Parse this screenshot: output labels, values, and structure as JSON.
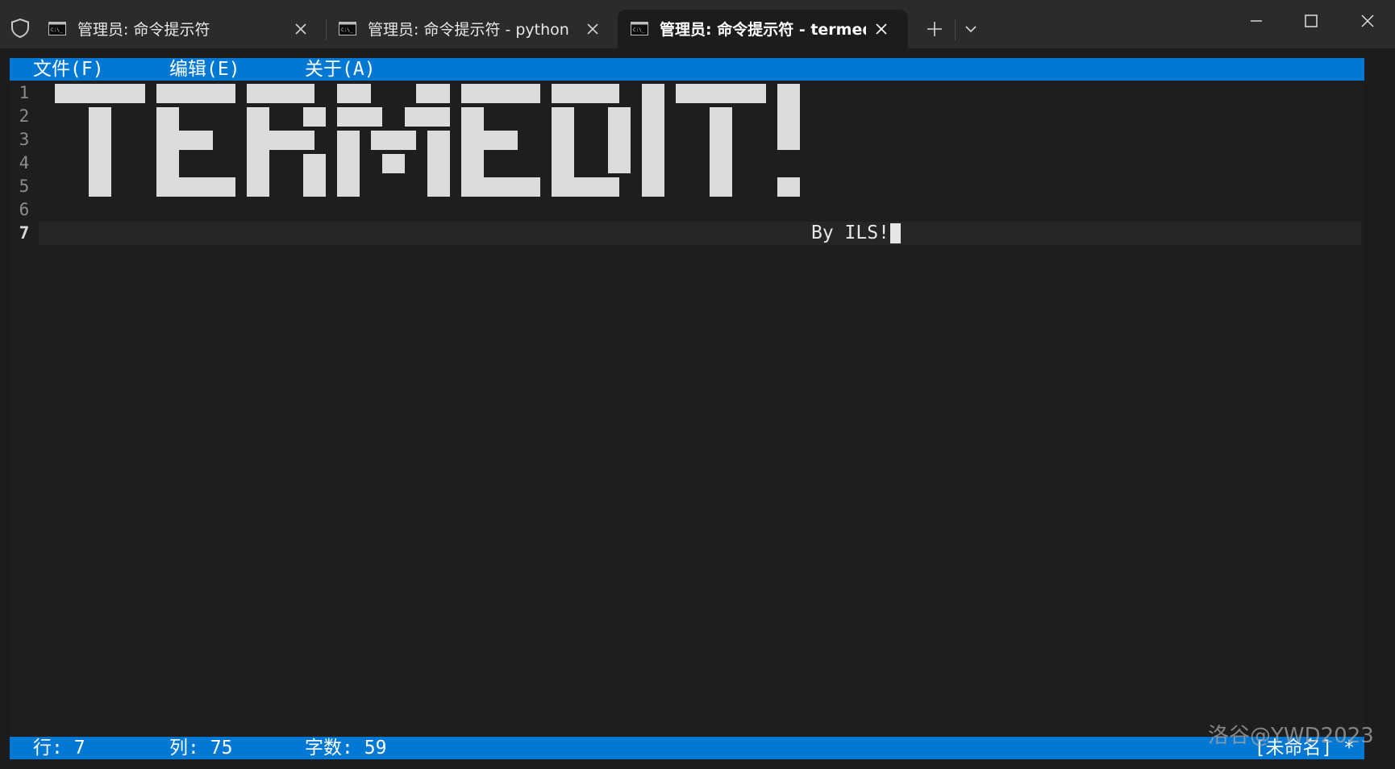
{
  "window": {
    "tabs": [
      {
        "title": "管理员: 命令提示符",
        "active": false
      },
      {
        "title": "管理员: 命令提示符 - python  termedit",
        "active": false
      },
      {
        "title": "管理员: 命令提示符 - termedit",
        "active": true
      }
    ],
    "icons": {
      "shield": "shield-icon",
      "tab": "command-prompt-icon",
      "close": "close-icon",
      "new_tab": "plus-icon",
      "dropdown": "chevron-down-icon",
      "minimize": "minimize-icon",
      "maximize": "maximize-icon",
      "close_window": "close-icon"
    }
  },
  "editor": {
    "menu": [
      {
        "label": "文件(F)"
      },
      {
        "label": "编辑(E)"
      },
      {
        "label": "关于(A)"
      }
    ],
    "line_numbers": [
      "1",
      "2",
      "3",
      "4",
      "5",
      "6",
      "7"
    ],
    "current_line": 7,
    "banner_word": "TERMEDIT!",
    "signature": "By ILS!",
    "status": {
      "row_label": "行:",
      "row_value": "7",
      "col_label": "列:",
      "col_value": "75",
      "count_label": "字数:",
      "count_value": "59",
      "filename": "[未命名] *"
    }
  },
  "watermark": "洛谷@YWD2023",
  "colors": {
    "accent": "#0078d4",
    "terminal_bg": "#1e1e1e",
    "titlebar_bg": "#2b2b2b",
    "block_text": "#dcdcdc"
  }
}
